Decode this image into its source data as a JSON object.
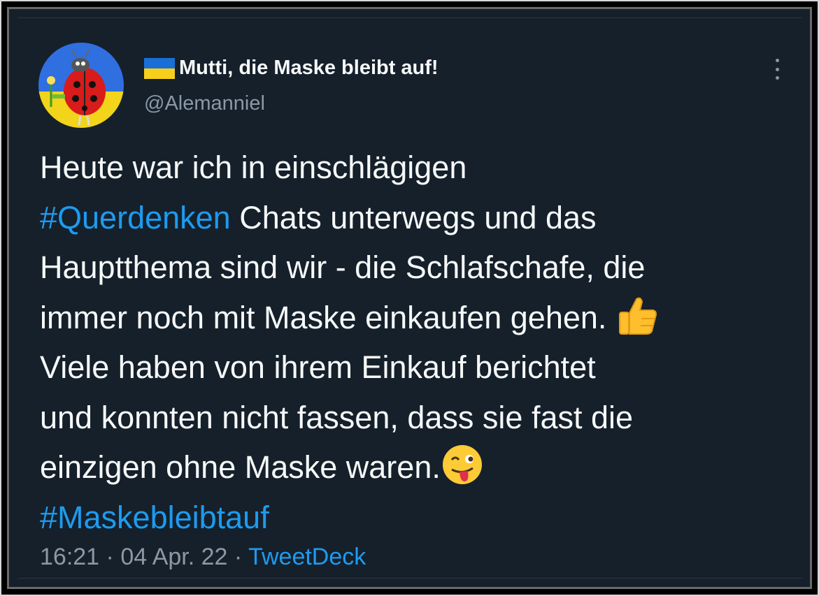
{
  "tweet": {
    "display_name": "Mutti, die Maske bleibt auf!",
    "name_flag_icon": "ukraine-flag-icon",
    "handle": "@Alemanniel",
    "avatar_icon": "ladybug-avatar",
    "more_icon": "more-vertical-icon",
    "body_lines": [
      [
        "Heute war ich in einschlägigen"
      ],
      [
        "#Querdenken",
        " Chats unterwegs und das"
      ],
      [
        "Hauptthema sind wir - die Schlafschafe, die"
      ],
      [
        "immer noch mit Maske einkaufen gehen. "
      ],
      [
        "Viele haben von ihrem Einkauf berichtet"
      ],
      [
        "und konnten nicht fassen, dass sie fast die"
      ],
      [
        "einzigen ohne Maske waren."
      ],
      [
        "#Maskebleibtauf"
      ]
    ],
    "hashtags": [
      "#Querdenken",
      "#Maskebleibtauf"
    ],
    "emojis": [
      "thumbs-up-icon",
      "winking-face-with-tongue-icon"
    ],
    "time": "16:21",
    "date": "04 Apr. 22",
    "separator": "·",
    "source": "TweetDeck"
  },
  "colors": {
    "background": "#15202b",
    "text": "#f7f9f9",
    "secondary": "#8b98a5",
    "link": "#1d9bf0"
  }
}
